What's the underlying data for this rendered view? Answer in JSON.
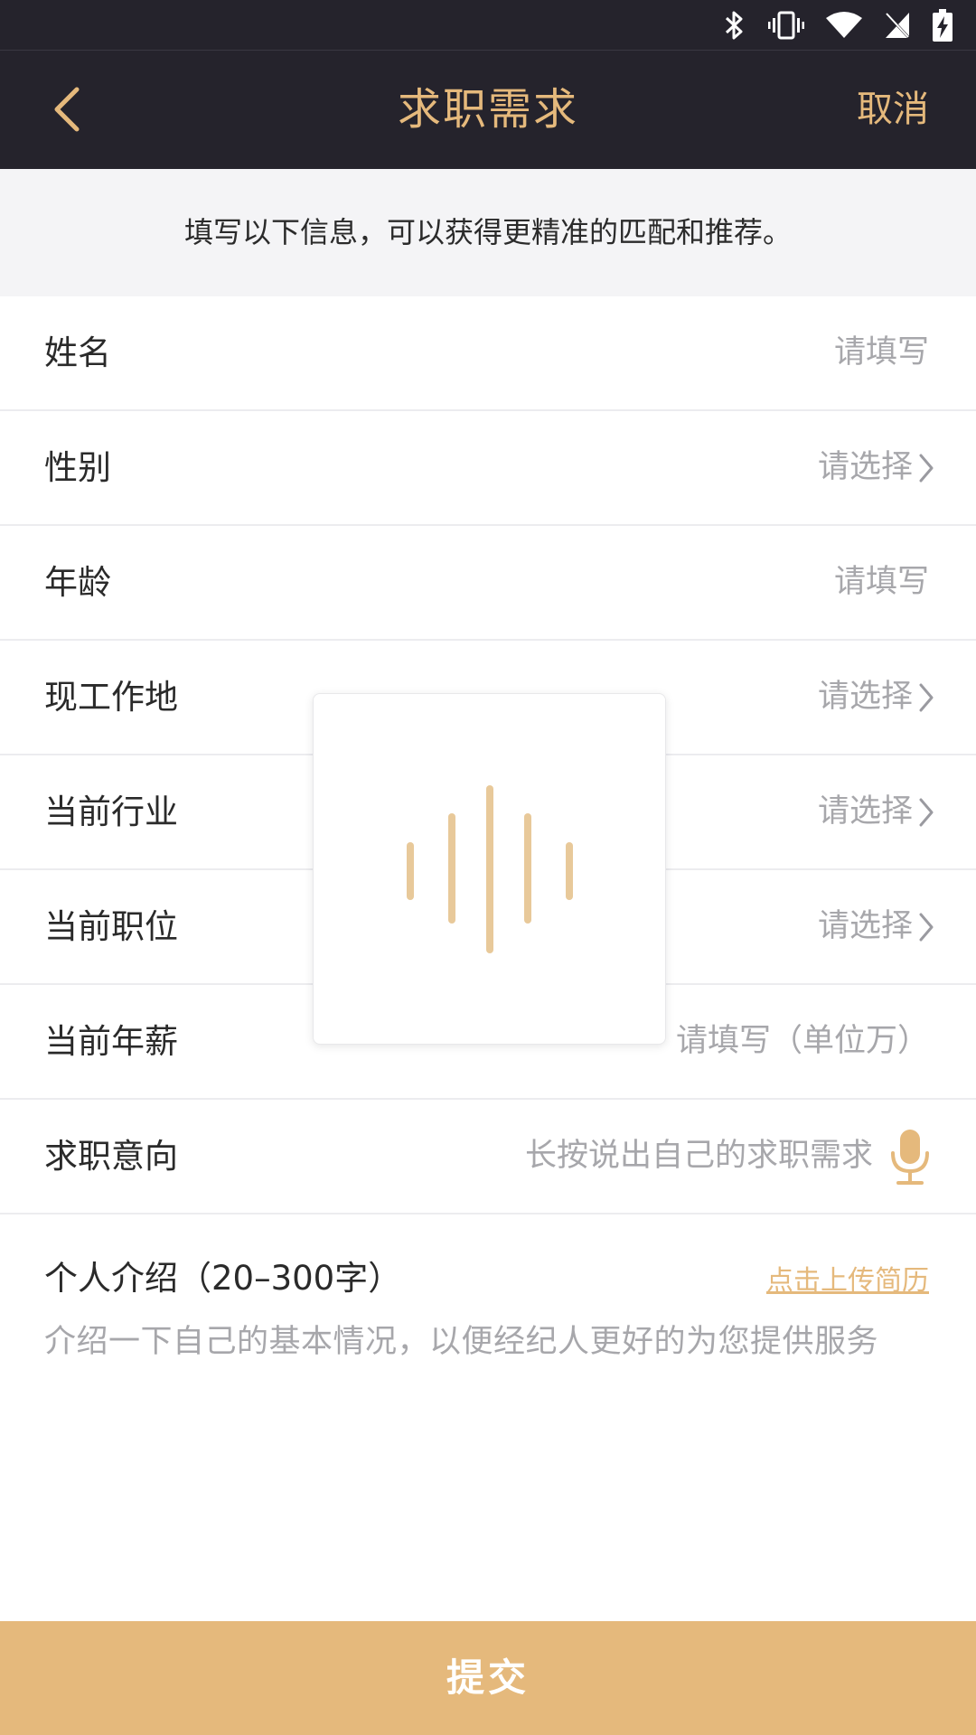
{
  "header": {
    "title": "求职需求",
    "cancel_label": "取消"
  },
  "intro_text": "填写以下信息，可以获得更精准的匹配和推荐。",
  "form": {
    "name": {
      "label": "姓名",
      "placeholder": "请填写"
    },
    "gender": {
      "label": "性别",
      "placeholder": "请选择"
    },
    "age": {
      "label": "年龄",
      "placeholder": "请填写"
    },
    "location": {
      "label": "现工作地",
      "placeholder": "请选择"
    },
    "industry": {
      "label": "当前行业",
      "placeholder": "请选择"
    },
    "position": {
      "label": "当前职位",
      "placeholder": "请选择"
    },
    "salary": {
      "label": "当前年薪",
      "placeholder": "请填写（单位万）"
    },
    "intention": {
      "label": "求职意向",
      "placeholder": "长按说出自己的求职需求"
    }
  },
  "intro_section": {
    "label": "个人介绍（20–300字）",
    "upload_link": "点击上传简历",
    "placeholder": "介绍一下自己的基本情况，以便经纪人更好的为您提供服务"
  },
  "submit_label": "提交",
  "colors": {
    "header_bg": "#25232c",
    "accent": "#e5b97c",
    "placeholder": "#a7a7ab"
  },
  "icons": {
    "back": "chevron-left-icon",
    "chevron": "chevron-right-icon",
    "mic": "microphone-icon",
    "voice_wave": "sound-wave-icon"
  }
}
